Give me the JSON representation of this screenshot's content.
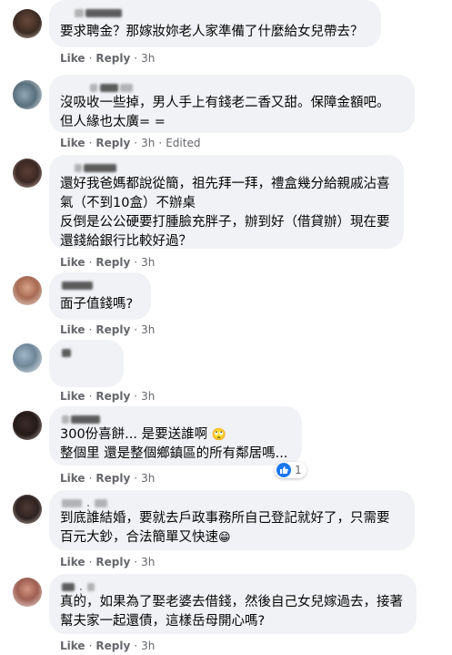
{
  "colors": {
    "bubble": "#f0f2f5",
    "meta": "#65676b",
    "like_blue": "#1877f2",
    "text": "#050505"
  },
  "actions": {
    "like": "Like",
    "reply": "Reply",
    "sep": "·"
  },
  "comments": [
    {
      "text": "要求聘金？那嫁妝妳老人家準備了什麼給女兒帶去？",
      "time": "3h"
    },
    {
      "text": "沒吸收一些掉，男人手上有錢老二香又甜。保障金額吧。\n但人緣也太廣= =",
      "time": "3h",
      "edited": "Edited"
    },
    {
      "text": "還好我爸媽都說從簡，祖先拜一拜，禮盒幾分給親戚沾喜氣（不到10盒）不辦桌\n反倒是公公硬要打腫臉充胖子，辦到好（借貸辦）現在要還錢給銀行比較好過？",
      "time": "3h"
    },
    {
      "text": "面子值錢嗎?",
      "time": "3h"
    },
    {
      "text": "",
      "time": "3h"
    },
    {
      "text_line1": "300份喜餅... 是要送誰啊",
      "emoji1": "🙄",
      "text_line2": "整個里 還是整個鄉鎮區的所有鄰居嗎...",
      "time": "3h",
      "reaction_count": "1",
      "reaction_icon": "thumbs-up-icon"
    },
    {
      "text_line1": "到底誰結婚，要就去戶政事務所自己登記就好了，只需要",
      "text_line2": "百元大鈔，合法簡單又快速",
      "emoji2": "😁",
      "time": "3h"
    },
    {
      "text": "真的，如果為了娶老婆去借錢，然後自己女兒嫁過去，接著幫夫家一起還債，這樣岳母開心嗎?",
      "time": "3h"
    }
  ]
}
